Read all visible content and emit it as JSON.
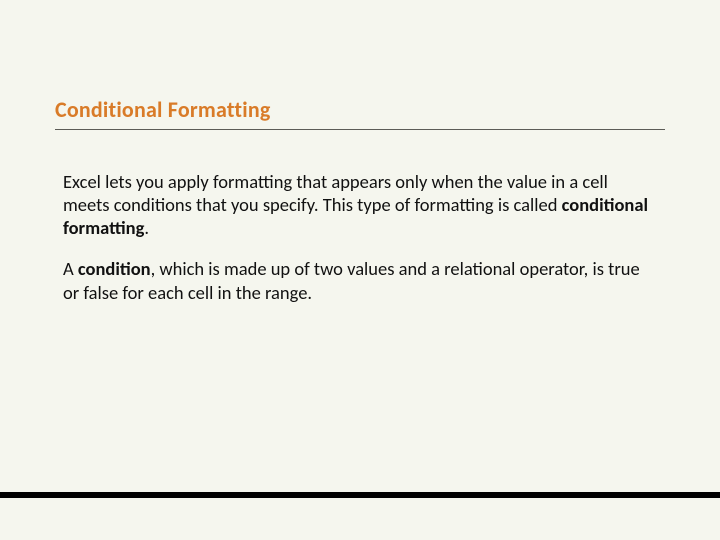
{
  "title": "Conditional Formatting",
  "p1": {
    "t1": "Excel lets you apply formatting that appears only when the value in a cell meets conditions that you specify. This type of formatting is called ",
    "b1": "conditional formatting",
    "t2": "."
  },
  "p2": {
    "t1": "A ",
    "b1": "condition",
    "t2": ", which is made up of two values and a relational operator, is true or false for each cell in the range."
  }
}
